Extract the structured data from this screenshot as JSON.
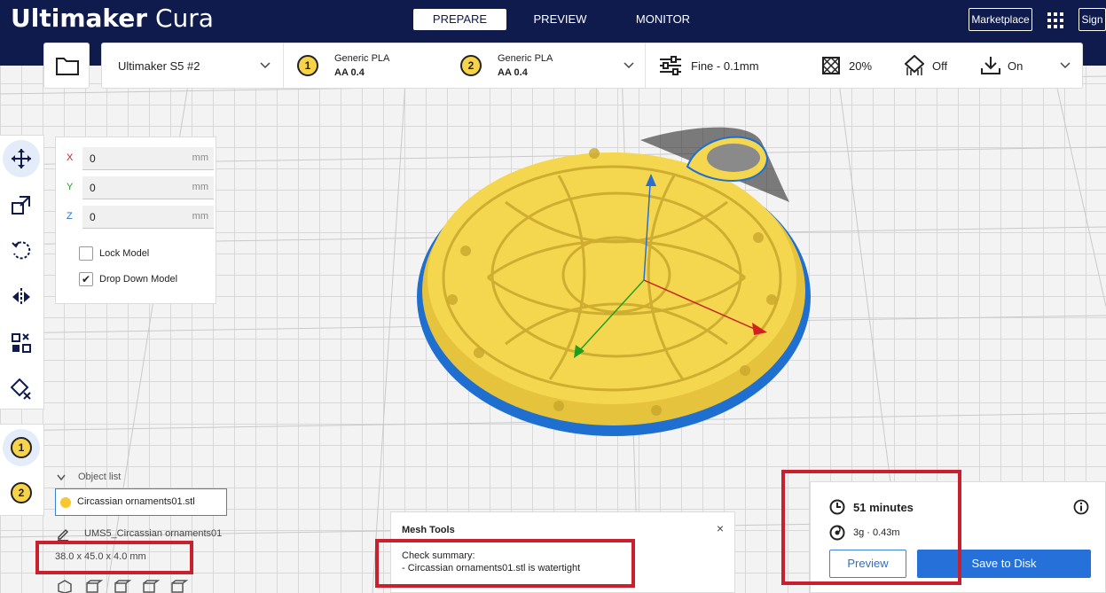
{
  "app": {
    "brand_bold": "Ultimaker",
    "brand_light": "Cura"
  },
  "stages": [
    {
      "label": "PREPARE",
      "active": true
    },
    {
      "label": "PREVIEW",
      "active": false
    },
    {
      "label": "MONITOR",
      "active": false
    }
  ],
  "header": {
    "marketplace_label": "Marketplace",
    "sign_label": "Sign"
  },
  "toolbar": {
    "printer": "Ultimaker S5 #2",
    "extruder1": {
      "number": "1",
      "material": "Generic PLA",
      "core": "AA 0.4"
    },
    "extruder2": {
      "number": "2",
      "material": "Generic PLA",
      "core": "AA 0.4"
    },
    "profile": "Fine - 0.1mm",
    "infill": "20%",
    "support": "Off",
    "adhesion": "On"
  },
  "move_panel": {
    "x": {
      "label": "X",
      "value": "0",
      "unit": "mm"
    },
    "y": {
      "label": "Y",
      "value": "0",
      "unit": "mm"
    },
    "z": {
      "label": "Z",
      "value": "0",
      "unit": "mm"
    },
    "lock_model": {
      "label": "Lock Model",
      "checked": false
    },
    "drop_down": {
      "label": "Drop Down Model",
      "checked": true,
      "mark": "✔"
    }
  },
  "extruder_buttons": [
    "1",
    "2"
  ],
  "object_list": {
    "toggle_label": "Object list",
    "item": "Circassian ornaments01.stl",
    "job_name": "UMS5_Circassian ornaments01",
    "dimensions": "38.0 x 45.0 x 4.0 mm"
  },
  "mesh_tools": {
    "title": "Mesh Tools",
    "close": "×",
    "line1": "Check summary:",
    "line2": "- Circassian ornaments01.stl is watertight"
  },
  "print": {
    "time": "51 minutes",
    "material": "3g · 0.43m",
    "preview_label": "Preview",
    "save_label": "Save to Disk"
  },
  "colors": {
    "header_bg": "#0f1b4d",
    "accent_blue": "#2671d9",
    "model_yellow": "#f5d64f",
    "highlight_red": "#c8202e"
  }
}
